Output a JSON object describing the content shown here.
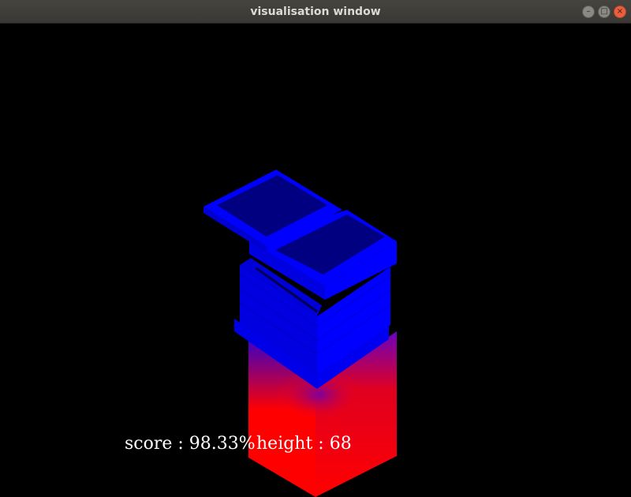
{
  "window": {
    "title": "visualisation window",
    "buttons": {
      "minimize_icon": "minimize-icon",
      "maximize_icon": "maximize-icon",
      "close_icon": "close-icon"
    }
  },
  "hud": {
    "score": "score : 98.33%",
    "height": "height : 68"
  },
  "colors": {
    "background": "#000000",
    "block_blue": "#0000ff",
    "block_dark_blue": "#000080",
    "base_red": "#ff0000",
    "titlebar": "#3c3b37",
    "close_button": "#e9603f"
  }
}
